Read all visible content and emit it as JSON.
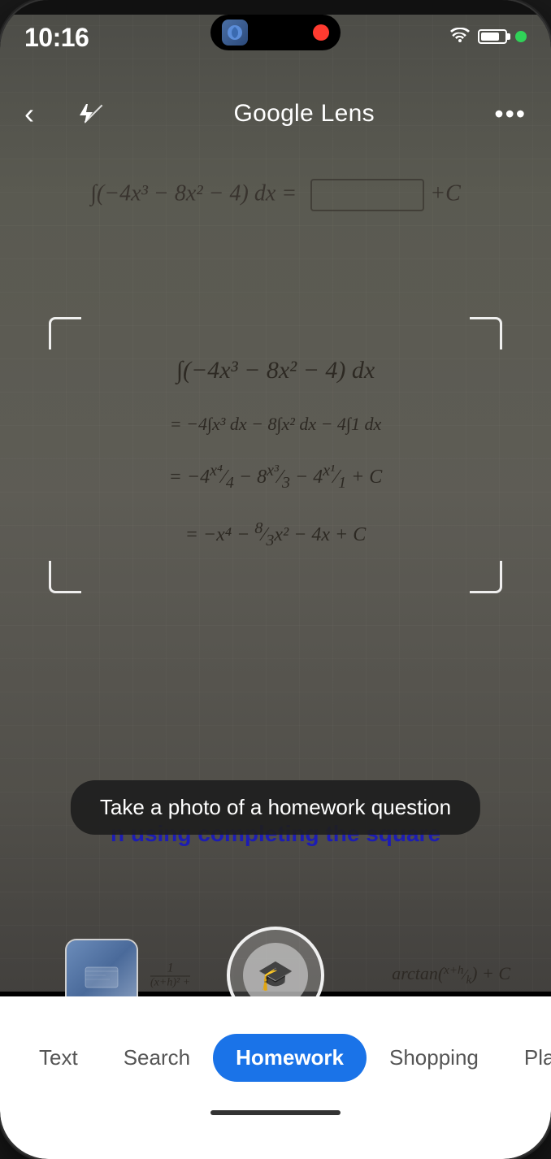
{
  "status": {
    "time": "10:16",
    "wifi": "wifi",
    "battery": "battery"
  },
  "header": {
    "title": "Google Lens",
    "back_label": "‹",
    "more_label": "•••"
  },
  "tooltip": {
    "text": "Take a photo of a homework question"
  },
  "completing_square": {
    "text": "n using completing the square"
  },
  "tabs": {
    "items": [
      {
        "label": "Text",
        "active": false
      },
      {
        "label": "Search",
        "active": false
      },
      {
        "label": "Homework",
        "active": true
      },
      {
        "label": "Shopping",
        "active": false
      },
      {
        "label": "Places",
        "active": false
      }
    ]
  }
}
